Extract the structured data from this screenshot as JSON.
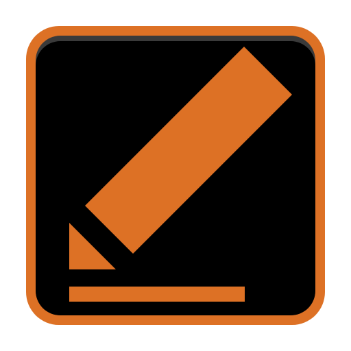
{
  "icon": {
    "name": "edit-pencil-icon",
    "colors": {
      "border": "#DD7125",
      "background": "#000000",
      "top_bevel": "#3A3A3A",
      "glyph": "#DD7125",
      "page": "#FFFFFF"
    }
  }
}
